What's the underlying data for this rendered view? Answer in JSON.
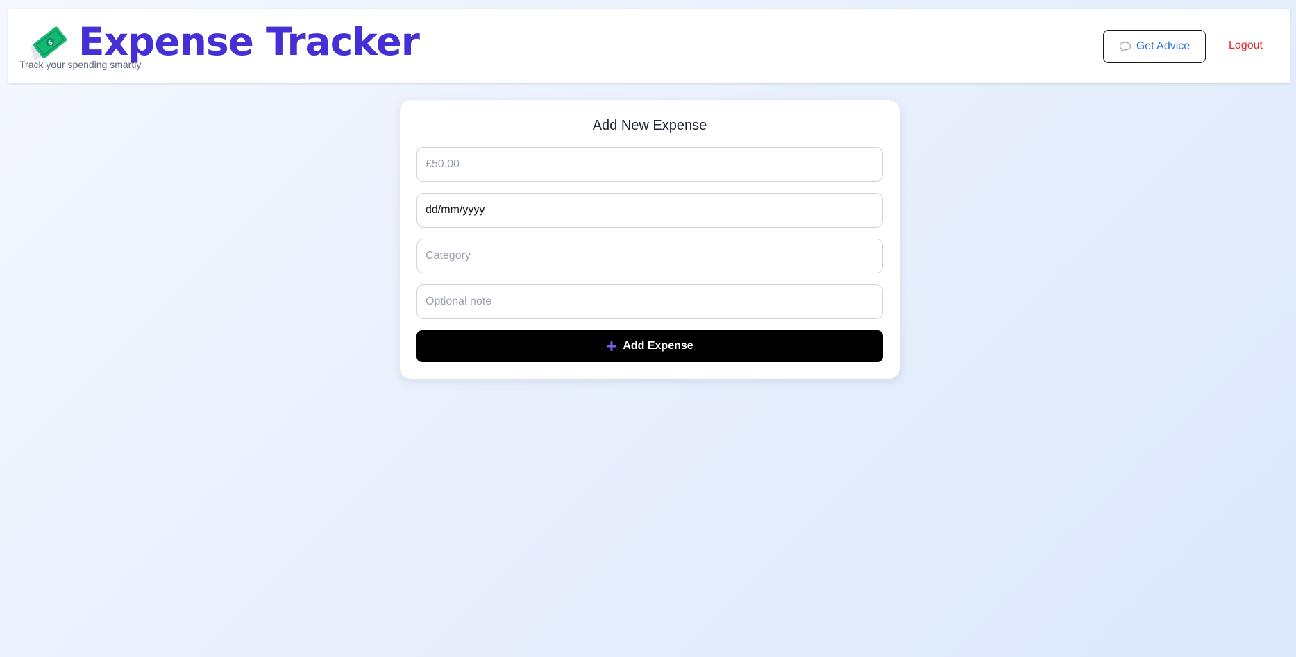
{
  "header": {
    "title": "Expense Tracker",
    "subtitle": "Track your spending smartly",
    "logo_icon": "money-with-wings-icon",
    "advice_label": "Get Advice",
    "advice_icon": "speech-bubble-icon",
    "logout_label": "Logout"
  },
  "form": {
    "title": "Add New Expense",
    "amount_placeholder": "£50.00",
    "amount_value": "",
    "date_value": "dd/mm/yyyy",
    "category_placeholder": "Category",
    "category_value": "",
    "note_placeholder": "Optional note",
    "note_value": "",
    "submit_label": "Add Expense",
    "submit_icon": "plus-icon"
  },
  "colors": {
    "brand": "#4430d4",
    "advice_text": "#2a6ee0",
    "logout": "#e0262d",
    "button_bg": "#000000",
    "plus_icon": "#7b5cf0"
  }
}
